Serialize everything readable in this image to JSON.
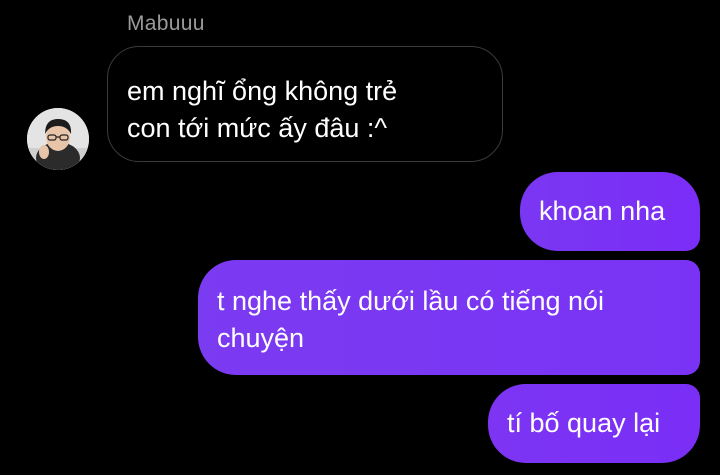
{
  "conversation": {
    "sender_name": "Mabuuu",
    "messages": [
      {
        "direction": "incoming",
        "text": "em nghĩ ổng không trẻ\ncon tới mức ấy đâu :^"
      },
      {
        "direction": "outgoing",
        "text": "khoan nha"
      },
      {
        "direction": "outgoing",
        "text": "t nghe thấy dưới lầu có tiếng nói\nchuyện"
      },
      {
        "direction": "outgoing",
        "text": "tí bố quay lại"
      }
    ]
  },
  "colors": {
    "background": "#000000",
    "outgoing_bubble": "#7a32f5",
    "incoming_bubble_border": "#3a3a3a",
    "sender_name": "#9a9a9a"
  }
}
